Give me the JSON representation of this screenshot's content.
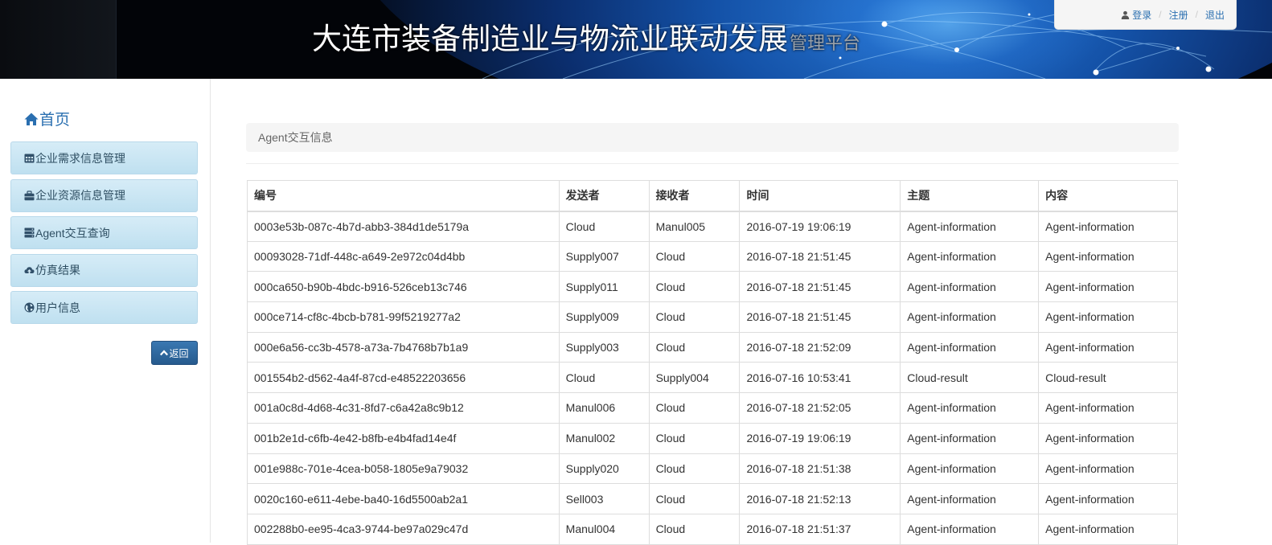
{
  "header": {
    "title": "大连市装备制造业与物流业联动发展",
    "subtitle": "管理平台",
    "auth": {
      "login": "登录",
      "register": "注册",
      "logout": "退出"
    }
  },
  "sidebar": {
    "home": "首页",
    "items": [
      {
        "label": "企业需求信息管理",
        "icon": "calendar-icon"
      },
      {
        "label": "企业资源信息管理",
        "icon": "briefcase-icon"
      },
      {
        "label": "Agent交互查询",
        "icon": "server-icon"
      },
      {
        "label": "仿真结果",
        "icon": "cloud-upload-icon"
      },
      {
        "label": "用户信息",
        "icon": "globe-icon"
      }
    ],
    "back": "返回"
  },
  "panel": {
    "heading": "Agent交互信息"
  },
  "table": {
    "headers": [
      "编号",
      "发送者",
      "接收者",
      "时间",
      "主题",
      "内容"
    ],
    "rows": [
      [
        "0003e53b-087c-4b7d-abb3-384d1de5179a",
        "Cloud",
        "Manul005",
        "2016-07-19 19:06:19",
        "Agent-information",
        "Agent-information"
      ],
      [
        "00093028-71df-448c-a649-2e972c04d4bb",
        "Supply007",
        "Cloud",
        "2016-07-18 21:51:45",
        "Agent-information",
        "Agent-information"
      ],
      [
        "000ca650-b90b-4bdc-b916-526ceb13c746",
        "Supply011",
        "Cloud",
        "2016-07-18 21:51:45",
        "Agent-information",
        "Agent-information"
      ],
      [
        "000ce714-cf8c-4bcb-b781-99f5219277a2",
        "Supply009",
        "Cloud",
        "2016-07-18 21:51:45",
        "Agent-information",
        "Agent-information"
      ],
      [
        "000e6a56-cc3b-4578-a73a-7b4768b7b1a9",
        "Supply003",
        "Cloud",
        "2016-07-18 21:52:09",
        "Agent-information",
        "Agent-information"
      ],
      [
        "001554b2-d562-4a4f-87cd-e48522203656",
        "Cloud",
        "Supply004",
        "2016-07-16 10:53:41",
        "Cloud-result",
        "Cloud-result"
      ],
      [
        "001a0c8d-4d68-4c31-8fd7-c6a42a8c9b12",
        "Manul006",
        "Cloud",
        "2016-07-18 21:52:05",
        "Agent-information",
        "Agent-information"
      ],
      [
        "001b2e1d-c6fb-4e42-b8fb-e4b4fad14e4f",
        "Manul002",
        "Cloud",
        "2016-07-19 19:06:19",
        "Agent-information",
        "Agent-information"
      ],
      [
        "001e988c-701e-4cea-b058-1805e9a79032",
        "Supply020",
        "Cloud",
        "2016-07-18 21:51:38",
        "Agent-information",
        "Agent-information"
      ],
      [
        "0020c160-e611-4ebe-ba40-16d5500ab2a1",
        "Sell003",
        "Cloud",
        "2016-07-18 21:52:13",
        "Agent-information",
        "Agent-information"
      ],
      [
        "002288b0-ee95-4ca3-9744-be97a029c47d",
        "Manul004",
        "Cloud",
        "2016-07-18 21:51:37",
        "Agent-information",
        "Agent-information"
      ]
    ]
  }
}
